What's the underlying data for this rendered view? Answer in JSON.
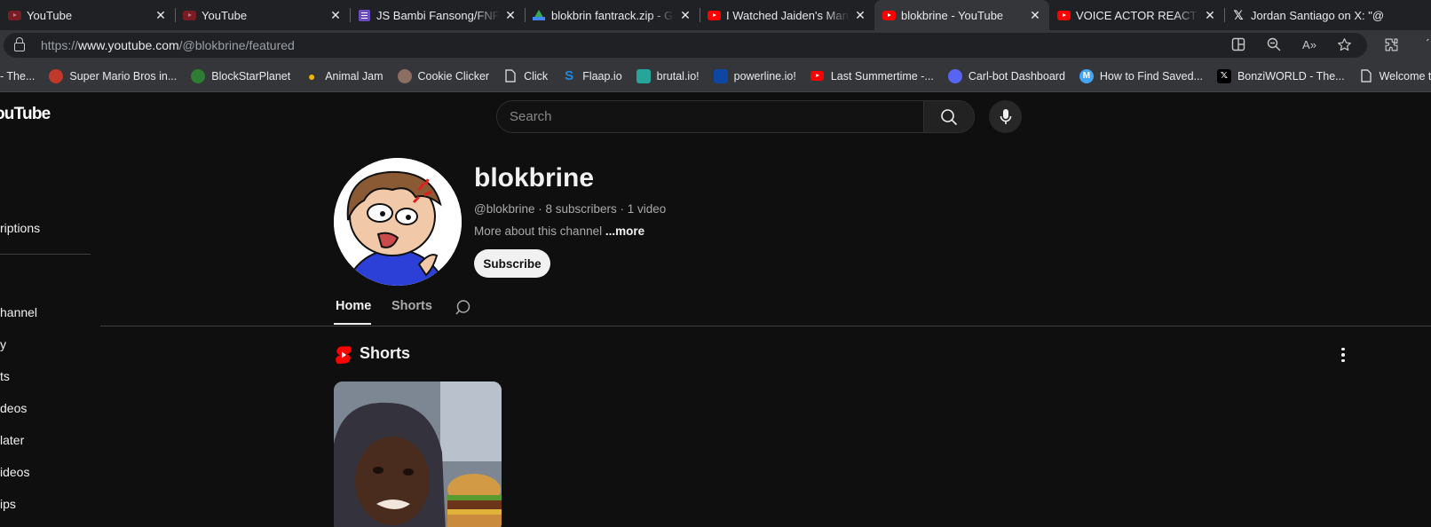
{
  "browser": {
    "tabs": [
      {
        "title": "YouTube",
        "favicon": "youtube-icon",
        "active": false
      },
      {
        "title": "YouTube",
        "favicon": "youtube-icon",
        "active": false
      },
      {
        "title": "JS Bambi Fansong/FNF Song",
        "favicon": "list-doc-icon",
        "active": false
      },
      {
        "title": "blokbrin fantrack.zip - Google Drive",
        "favicon": "google-drive-icon",
        "active": false
      },
      {
        "title": "I Watched Jaiden's Mario",
        "favicon": "youtube-icon",
        "active": false
      },
      {
        "title": "blokbrine - YouTube",
        "favicon": "youtube-icon",
        "active": true
      },
      {
        "title": "VOICE ACTOR REACTS: B",
        "favicon": "youtube-icon",
        "active": false
      },
      {
        "title": "Jordan Santiago on X: \"@",
        "favicon": "x-icon",
        "active": false
      }
    ],
    "url_prefix": "https://",
    "url_host": "www.youtube.com",
    "url_path": "/@blokbrine/featured",
    "bookmarks": [
      {
        "label": "- The...",
        "icon": "page-icon",
        "color": "#35363a"
      },
      {
        "label": "Super Mario Bros in...",
        "icon": "mario-icon",
        "color": "#c0392b"
      },
      {
        "label": "BlockStarPlanet",
        "icon": "blockstar-icon",
        "color": "#2e7d32"
      },
      {
        "label": "Animal Jam",
        "icon": "paw-icon",
        "color": "#f4b400"
      },
      {
        "label": "Cookie Clicker",
        "icon": "cookie-icon",
        "color": "#8d6e63"
      },
      {
        "label": "Click",
        "icon": "page-icon",
        "color": "#35363a"
      },
      {
        "label": "Flaap.io",
        "icon": "flaap-icon",
        "color": "#1565c0"
      },
      {
        "label": "brutal.io!",
        "icon": "link-icon",
        "color": "#26a69a"
      },
      {
        "label": "powerline.io!",
        "icon": "powerline-icon",
        "color": "#1e88e5"
      },
      {
        "label": "Last Summertime -...",
        "icon": "youtube-icon",
        "color": "#ff0000"
      },
      {
        "label": "Carl-bot Dashboard",
        "icon": "discord-icon",
        "color": "#5865f2"
      },
      {
        "label": "How to Find Saved...",
        "icon": "m-icon",
        "color": "#42a5f5"
      },
      {
        "label": "BonziWORLD - The...",
        "icon": "x-icon",
        "color": "#000000"
      },
      {
        "label": "Welcome to Sky!",
        "icon": "page-icon",
        "color": "#35363a"
      }
    ]
  },
  "youtube": {
    "logo_text": "ouTube",
    "search_placeholder": "Search",
    "sidebar": [
      {
        "label": "riptions"
      },
      {
        "label": "hannel"
      },
      {
        "label": "y"
      },
      {
        "label": "ts"
      },
      {
        "label": "deos"
      },
      {
        "label": "later"
      },
      {
        "label": "ideos"
      },
      {
        "label": "ips"
      }
    ],
    "channel": {
      "name": "blokbrine",
      "meta": "@blokbrine · 8 subscribers · 1 video",
      "about": "More about this channel",
      "more": "...more",
      "subscribe_label": "Subscribe"
    },
    "tabs": [
      {
        "label": "Home",
        "active": true
      },
      {
        "label": "Shorts",
        "active": false
      }
    ],
    "shelf": {
      "title": "Shorts"
    }
  },
  "colors": {
    "background": "#0f0f0f",
    "tab_strip": "#202124",
    "toolbar": "#35363a",
    "youtube_red": "#ff0000"
  }
}
